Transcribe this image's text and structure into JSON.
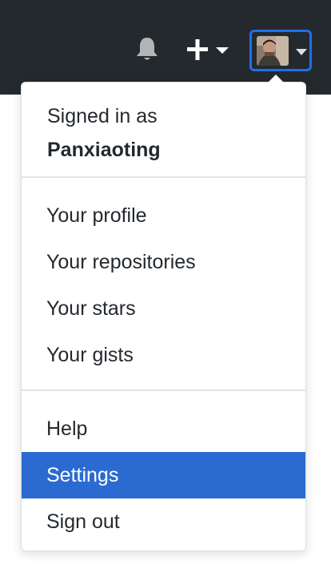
{
  "header": {
    "notification_icon": "bell-icon",
    "create_icon": "plus-icon",
    "caret_icon": "caret-down-icon",
    "avatar_icon": "avatar-image",
    "colors": {
      "bar": "#24292e",
      "icon": "#ffffff",
      "focus_ring": "#1f6fea"
    }
  },
  "menu": {
    "signed_in_label": "Signed in as",
    "username": "Panxiaoting",
    "profile_group": [
      {
        "label": "Your profile"
      },
      {
        "label": "Your repositories"
      },
      {
        "label": "Your stars"
      },
      {
        "label": "Your gists"
      }
    ],
    "account_group": [
      {
        "label": "Help"
      },
      {
        "label": "Settings"
      },
      {
        "label": "Sign out"
      }
    ],
    "active_item": "Settings",
    "colors": {
      "active_bg": "#2b6bd1",
      "active_text": "#ffffff",
      "text": "#24292e",
      "divider": "#e1e4e8"
    }
  }
}
